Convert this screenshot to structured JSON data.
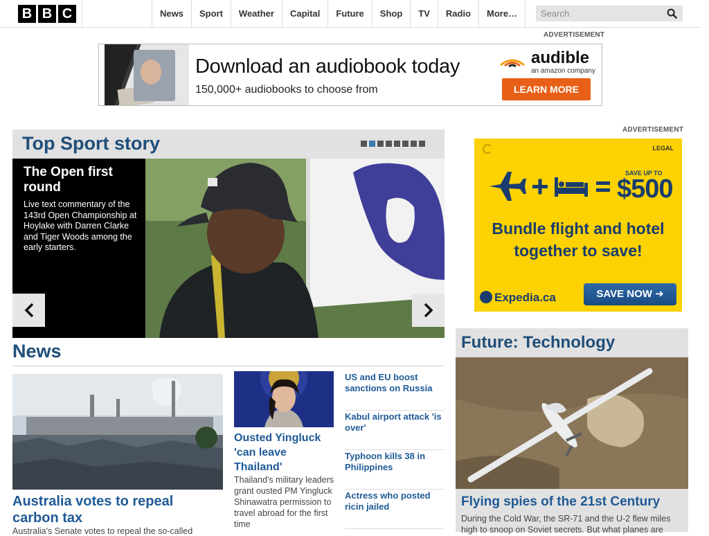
{
  "logo": [
    "B",
    "B",
    "C"
  ],
  "nav": [
    "News",
    "Sport",
    "Weather",
    "Capital",
    "Future",
    "Shop",
    "TV",
    "Radio",
    "More…"
  ],
  "search": {
    "placeholder": "Search"
  },
  "ads": {
    "label": "ADVERTISEMENT",
    "banner": {
      "headline": "Download an audiobook today",
      "subline": "150,000+ audiobooks to choose from",
      "brand": "audible",
      "brand_sub": "an amazon company",
      "cta": "LEARN MORE",
      "cta_color": "#e86017"
    },
    "side": {
      "legal": "LEGAL",
      "save_up": "SAVE UP TO",
      "price": "$500",
      "tagline_1": "Bundle flight and hotel",
      "tagline_2": "together to save!",
      "brand": "Expedia.ca",
      "cta": "SAVE NOW ➜",
      "bg_color": "#fcd202"
    }
  },
  "top_sport": {
    "heading": "Top Sport story",
    "slides": 8,
    "active_slide": 2,
    "title": "The Open first round",
    "summary": "Live text commentary of the 143rd Open Championship at Hoylake with Darren Clarke and Tiger Woods among the early starters.",
    "prev_icon": "chevron-left-icon",
    "next_icon": "chevron-right-icon"
  },
  "news": {
    "heading": "News",
    "lead": {
      "title": "Australia votes to repeal carbon tax",
      "summary": "Australia's Senate votes to repeal the so-called"
    },
    "second": {
      "title": "Ousted Yingluck 'can leave Thailand'",
      "summary": "Thailand's military leaders grant ousted PM Yingluck Shinawatra permission to travel abroad for the first time"
    },
    "headlines": [
      "US and EU boost sanctions on Russia",
      "Kabul airport attack 'is over'",
      "Typhoon kills 38 in Philippines",
      "Actress who posted ricin jailed"
    ]
  },
  "future": {
    "heading": "Future: Technology",
    "title": "Flying spies of the 21st Century",
    "summary": "During the Cold War, the SR-71 and the U-2 flew miles high to snoop on Soviet secrets. But what planes are"
  },
  "colors": {
    "heading_blue": "#1f4e79",
    "link_blue": "#1f5a96"
  }
}
